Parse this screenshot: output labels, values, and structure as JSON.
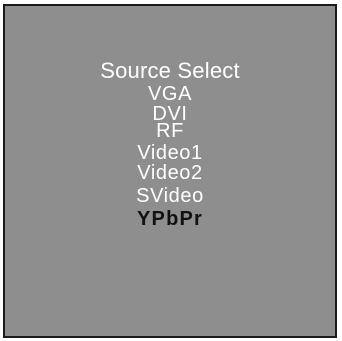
{
  "menu": {
    "title": "Source Select",
    "items": [
      {
        "label": "VGA",
        "selected": false
      },
      {
        "label": "DVI",
        "selected": false
      },
      {
        "label": "RF",
        "selected": false
      },
      {
        "label": "Video1",
        "selected": false
      },
      {
        "label": "Video2",
        "selected": false
      },
      {
        "label": "SVideo",
        "selected": false
      },
      {
        "label": "YPbPr",
        "selected": true
      }
    ]
  },
  "colors": {
    "background": "#8e8e8e",
    "border": "#1a1a1a",
    "text": "#ffffff",
    "selected_text": "#111111"
  }
}
